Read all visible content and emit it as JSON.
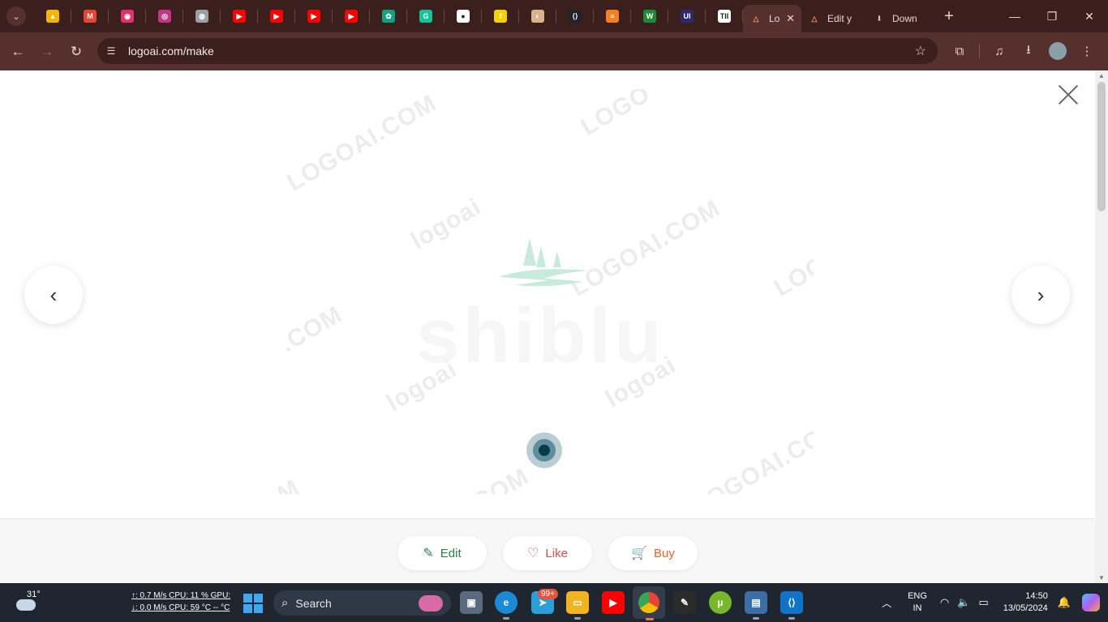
{
  "browser": {
    "pinned_tabs": [
      {
        "icon": "google-drive-icon",
        "color": "#f4b400",
        "glyph": "▲"
      },
      {
        "icon": "gmail-icon",
        "color": "#ea4335",
        "glyph": "M"
      },
      {
        "icon": "instagram-icon-1",
        "color": "#e1306c",
        "glyph": "◉"
      },
      {
        "icon": "instagram-icon-2",
        "color": "#c13584",
        "glyph": "◎"
      },
      {
        "icon": "globe-icon",
        "color": "#9aa0a6",
        "glyph": "◍"
      },
      {
        "icon": "youtube-icon-1",
        "color": "#ff0000",
        "glyph": "▶"
      },
      {
        "icon": "youtube-icon-2",
        "color": "#ff0000",
        "glyph": "▶"
      },
      {
        "icon": "youtube-icon-3",
        "color": "#ff0000",
        "glyph": "▶"
      },
      {
        "icon": "youtube-icon-4",
        "color": "#ff0000",
        "glyph": "▶"
      },
      {
        "icon": "chatgpt-icon",
        "color": "#10a37f",
        "glyph": "✿"
      },
      {
        "icon": "grammarly-icon",
        "color": "#15c39a",
        "glyph": "G"
      },
      {
        "icon": "white-circle-icon",
        "color": "#ffffff",
        "glyph": "●"
      },
      {
        "icon": "flipkart-icon",
        "color": "#f8d000",
        "glyph": "f"
      },
      {
        "icon": "profile-icon",
        "color": "#d9b38c",
        "glyph": "◐"
      },
      {
        "icon": "react-icon",
        "color": "#20232a",
        "glyph": "⟨⟩"
      },
      {
        "icon": "stack-overflow-icon",
        "color": "#f48024",
        "glyph": "≡"
      },
      {
        "icon": "wix-icon",
        "color": "#1f8a3a",
        "glyph": "W"
      },
      {
        "icon": "ui-icon",
        "color": "#2b2b6b",
        "glyph": "UI"
      },
      {
        "icon": "tii-icon",
        "color": "#ffffff",
        "glyph": "TII"
      }
    ],
    "active_tab": {
      "title": "Lo",
      "icon": "logoai-icon"
    },
    "tabs": [
      {
        "title": "Edit y",
        "icon": "logoai-icon"
      },
      {
        "title": "Down",
        "icon": "download-icon"
      }
    ],
    "url": "logoai.com/make"
  },
  "page": {
    "watermarks": [
      "LOGOAI.COM",
      "LOGO",
      "logoai",
      "LOGOAI.COM",
      "LOG",
      ".COM",
      "logoai",
      "logoai",
      "LOGOAI.COM",
      "M",
      ".COM",
      "logoai"
    ],
    "logo_text": "shiblu",
    "buttons": {
      "edit": "Edit",
      "like": "Like",
      "buy": "Buy"
    },
    "colors": {
      "edit": "#2f7d4e",
      "like": "#e24a4a",
      "buy": "#e8612c",
      "logo_mark": "#c8eadc"
    }
  },
  "taskbar": {
    "weather_temp": "31°",
    "net_up": "↑: 0.7 M/s",
    "cpu": "CPU: 11 %",
    "gpu": "GPU:",
    "net_down": "↓: 0.0 M/s",
    "cpu_temp": "CPU: 59 °C",
    "gpu_temp": "-- °C",
    "search_label": "Search",
    "notification_badge": "99+",
    "lang_line1": "ENG",
    "lang_line2": "IN",
    "time": "14:50",
    "date": "13/05/2024"
  }
}
